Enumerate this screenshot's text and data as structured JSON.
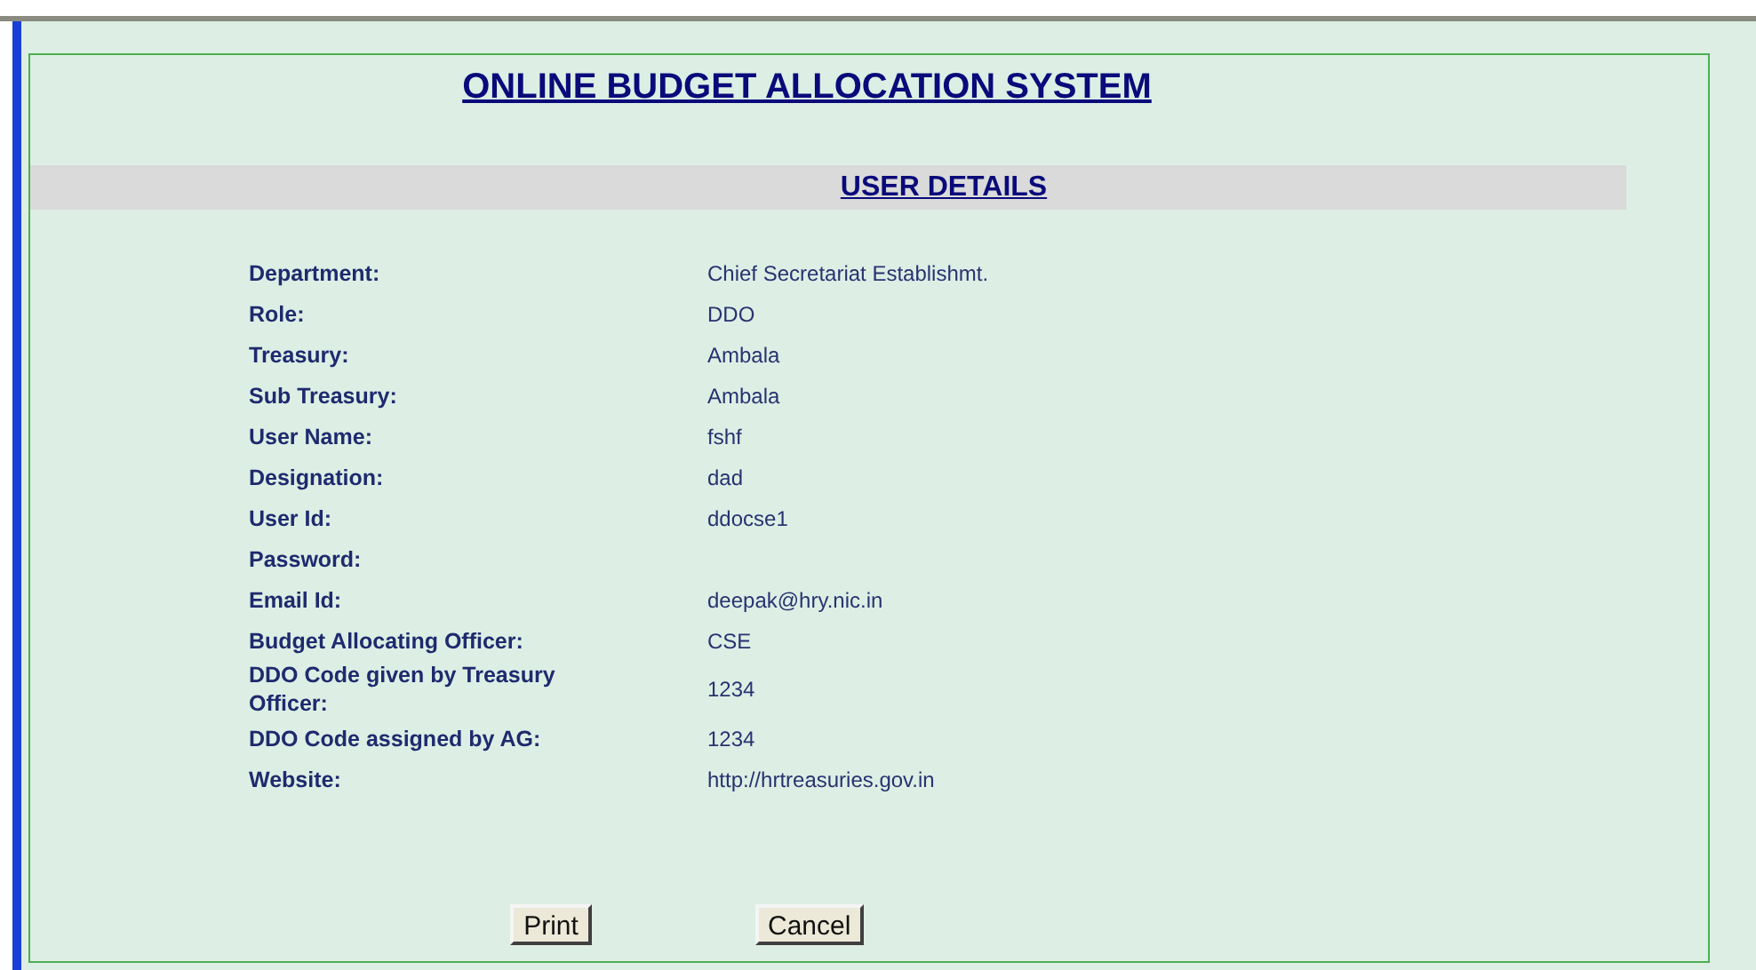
{
  "title": "ONLINE BUDGET ALLOCATION SYSTEM",
  "section_title": "USER DETAILS",
  "fields": [
    {
      "label": "Department:",
      "value": "Chief Secretariat Establishmt."
    },
    {
      "label": "Role:",
      "value": "DDO"
    },
    {
      "label": "Treasury:",
      "value": "Ambala"
    },
    {
      "label": "Sub Treasury:",
      "value": "Ambala"
    },
    {
      "label": "User Name:",
      "value": "fshf"
    },
    {
      "label": "Designation:",
      "value": "dad"
    },
    {
      "label": "User Id:",
      "value": "ddocse1"
    },
    {
      "label": "Password:"
    },
    {
      "label": "Email Id:",
      "value": "deepak@hry.nic.in"
    },
    {
      "label": "Budget Allocating Officer:",
      "value": "CSE"
    },
    {
      "label": "DDO Code given by Treasury Officer:",
      "value": "1234"
    },
    {
      "label": "DDO Code assigned by AG:",
      "value": "1234"
    },
    {
      "label": "Website:",
      "value": "http://hrtreasuries.gov.in"
    }
  ],
  "buttons": [
    "Print",
    "Cancel"
  ]
}
